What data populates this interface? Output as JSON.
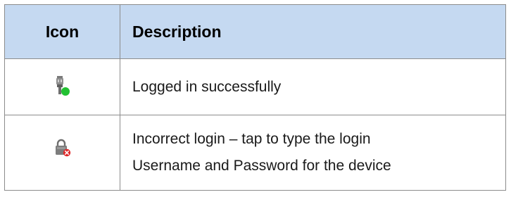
{
  "table": {
    "headers": {
      "icon": "Icon",
      "description": "Description"
    },
    "rows": [
      {
        "icon": "plug-connected-green-dot-icon",
        "lines": [
          "Logged in successfully"
        ]
      },
      {
        "icon": "padlock-red-x-icon",
        "lines": [
          "Incorrect login – tap to type the login",
          "Username and Password for the device"
        ]
      }
    ]
  },
  "colors": {
    "header_background": "#c5d9f1",
    "border": "#8c8c8c",
    "status_ok": "#22c132",
    "status_error": "#e02a2a"
  }
}
